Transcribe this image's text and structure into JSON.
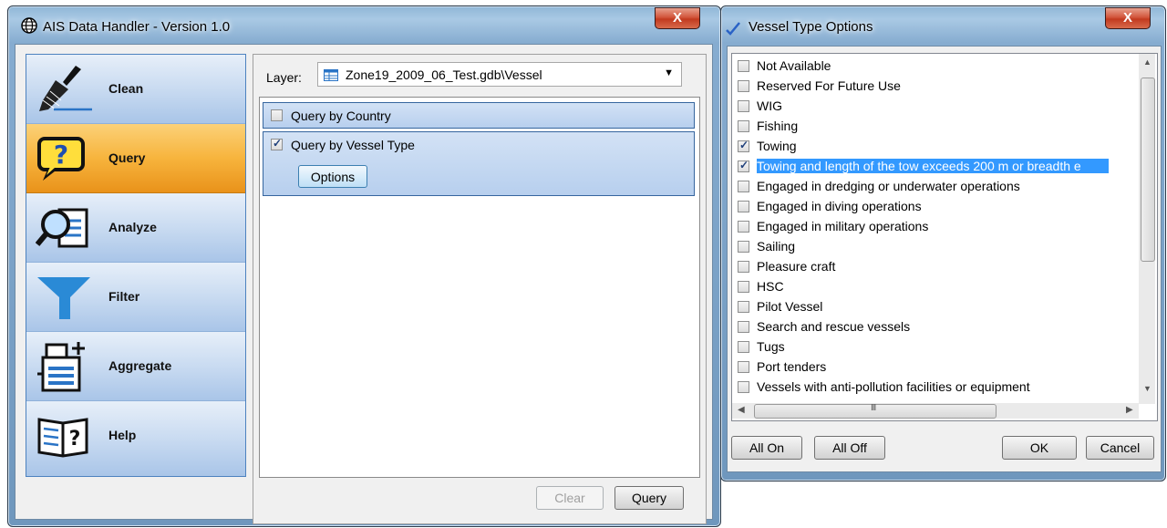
{
  "main_window": {
    "title": "AIS Data Handler - Version 1.0",
    "close_label": "X"
  },
  "nav": {
    "items": [
      {
        "label": "Clean",
        "icon": "broom-icon",
        "active": false
      },
      {
        "label": "Query",
        "icon": "query-speech-icon",
        "active": true
      },
      {
        "label": "Analyze",
        "icon": "magnifier-document-icon",
        "active": false
      },
      {
        "label": "Filter",
        "icon": "funnel-icon",
        "active": false
      },
      {
        "label": "Aggregate",
        "icon": "aggregate-document-icon",
        "active": false
      },
      {
        "label": "Help",
        "icon": "book-help-icon",
        "active": false
      }
    ]
  },
  "query_panel": {
    "layer_label": "Layer:",
    "layer_value": "Zone19_2009_06_Test.gdb\\Vessel",
    "sections": [
      {
        "label": "Query by Country",
        "checked": false
      },
      {
        "label": "Query by Vessel Type",
        "checked": true
      }
    ],
    "options_label": "Options",
    "clear_label": "Clear",
    "query_label": "Query"
  },
  "vessel_dialog": {
    "title": "Vessel Type Options",
    "close_label": "X",
    "items": [
      {
        "label": "Not Available",
        "checked": false
      },
      {
        "label": "Reserved For Future Use",
        "checked": false
      },
      {
        "label": "WIG",
        "checked": false
      },
      {
        "label": "Fishing",
        "checked": false
      },
      {
        "label": "Towing",
        "checked": true
      },
      {
        "label": "Towing and length of the tow exceeds 200 m or breadth e",
        "checked": true,
        "selected": true
      },
      {
        "label": "Engaged in dredging or underwater operations",
        "checked": false
      },
      {
        "label": "Engaged in diving operations",
        "checked": false
      },
      {
        "label": "Engaged in military operations",
        "checked": false
      },
      {
        "label": "Sailing",
        "checked": false
      },
      {
        "label": "Pleasure craft",
        "checked": false
      },
      {
        "label": "HSC",
        "checked": false
      },
      {
        "label": "Pilot Vessel",
        "checked": false
      },
      {
        "label": "Search and rescue vessels",
        "checked": false
      },
      {
        "label": "Tugs",
        "checked": false
      },
      {
        "label": "Port tenders",
        "checked": false
      },
      {
        "label": "Vessels with anti-pollution facilities or equipment",
        "checked": false
      }
    ],
    "all_on_label": "All On",
    "all_off_label": "All Off",
    "ok_label": "OK",
    "cancel_label": "Cancel"
  },
  "colors": {
    "active_nav": "#f7b43d",
    "nav": "#c9dbf1",
    "selection": "#3399ff"
  }
}
